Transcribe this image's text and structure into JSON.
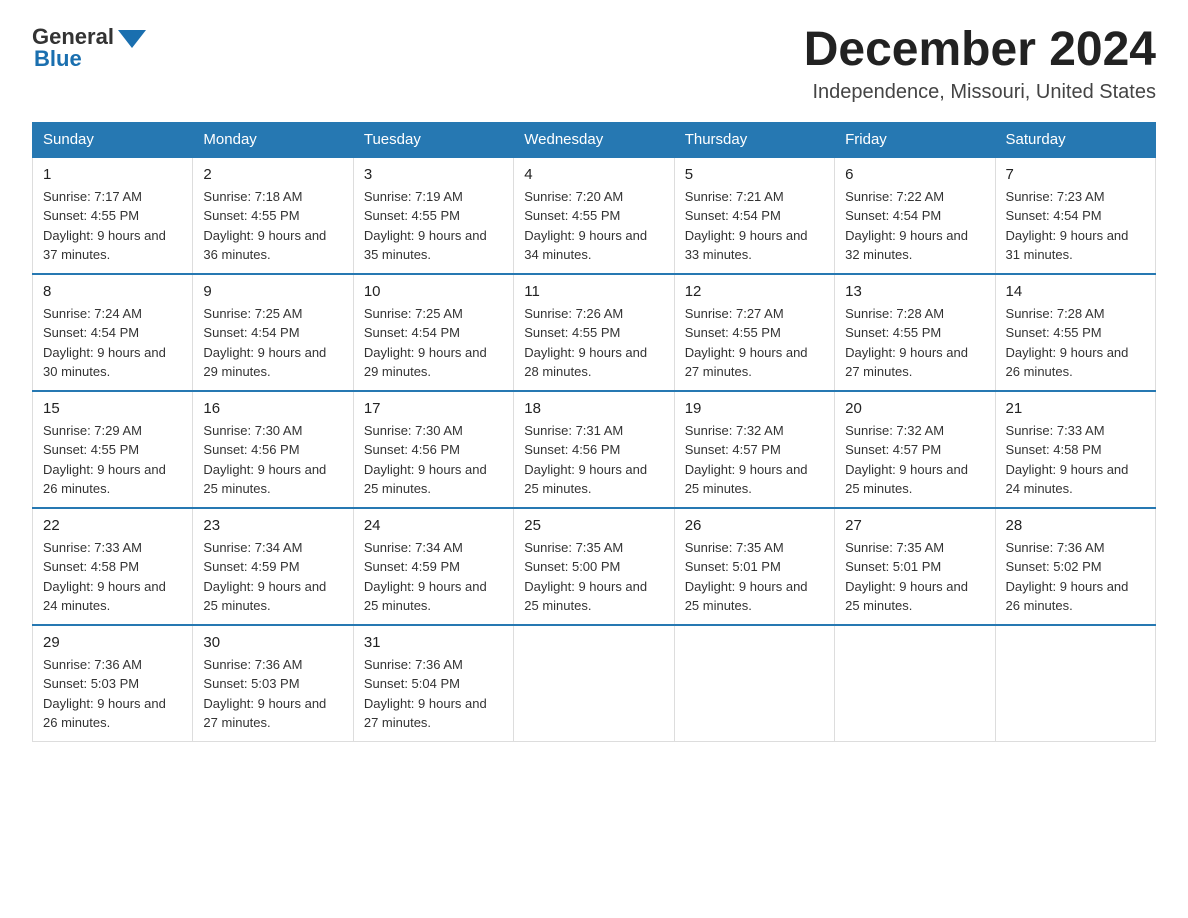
{
  "logo": {
    "general": "General",
    "blue": "Blue"
  },
  "title": "December 2024",
  "subtitle": "Independence, Missouri, United States",
  "headers": [
    "Sunday",
    "Monday",
    "Tuesday",
    "Wednesday",
    "Thursday",
    "Friday",
    "Saturday"
  ],
  "weeks": [
    [
      {
        "day": "1",
        "sunrise": "7:17 AM",
        "sunset": "4:55 PM",
        "daylight": "9 hours and 37 minutes."
      },
      {
        "day": "2",
        "sunrise": "7:18 AM",
        "sunset": "4:55 PM",
        "daylight": "9 hours and 36 minutes."
      },
      {
        "day": "3",
        "sunrise": "7:19 AM",
        "sunset": "4:55 PM",
        "daylight": "9 hours and 35 minutes."
      },
      {
        "day": "4",
        "sunrise": "7:20 AM",
        "sunset": "4:55 PM",
        "daylight": "9 hours and 34 minutes."
      },
      {
        "day": "5",
        "sunrise": "7:21 AM",
        "sunset": "4:54 PM",
        "daylight": "9 hours and 33 minutes."
      },
      {
        "day": "6",
        "sunrise": "7:22 AM",
        "sunset": "4:54 PM",
        "daylight": "9 hours and 32 minutes."
      },
      {
        "day": "7",
        "sunrise": "7:23 AM",
        "sunset": "4:54 PM",
        "daylight": "9 hours and 31 minutes."
      }
    ],
    [
      {
        "day": "8",
        "sunrise": "7:24 AM",
        "sunset": "4:54 PM",
        "daylight": "9 hours and 30 minutes."
      },
      {
        "day": "9",
        "sunrise": "7:25 AM",
        "sunset": "4:54 PM",
        "daylight": "9 hours and 29 minutes."
      },
      {
        "day": "10",
        "sunrise": "7:25 AM",
        "sunset": "4:54 PM",
        "daylight": "9 hours and 29 minutes."
      },
      {
        "day": "11",
        "sunrise": "7:26 AM",
        "sunset": "4:55 PM",
        "daylight": "9 hours and 28 minutes."
      },
      {
        "day": "12",
        "sunrise": "7:27 AM",
        "sunset": "4:55 PM",
        "daylight": "9 hours and 27 minutes."
      },
      {
        "day": "13",
        "sunrise": "7:28 AM",
        "sunset": "4:55 PM",
        "daylight": "9 hours and 27 minutes."
      },
      {
        "day": "14",
        "sunrise": "7:28 AM",
        "sunset": "4:55 PM",
        "daylight": "9 hours and 26 minutes."
      }
    ],
    [
      {
        "day": "15",
        "sunrise": "7:29 AM",
        "sunset": "4:55 PM",
        "daylight": "9 hours and 26 minutes."
      },
      {
        "day": "16",
        "sunrise": "7:30 AM",
        "sunset": "4:56 PM",
        "daylight": "9 hours and 25 minutes."
      },
      {
        "day": "17",
        "sunrise": "7:30 AM",
        "sunset": "4:56 PM",
        "daylight": "9 hours and 25 minutes."
      },
      {
        "day": "18",
        "sunrise": "7:31 AM",
        "sunset": "4:56 PM",
        "daylight": "9 hours and 25 minutes."
      },
      {
        "day": "19",
        "sunrise": "7:32 AM",
        "sunset": "4:57 PM",
        "daylight": "9 hours and 25 minutes."
      },
      {
        "day": "20",
        "sunrise": "7:32 AM",
        "sunset": "4:57 PM",
        "daylight": "9 hours and 25 minutes."
      },
      {
        "day": "21",
        "sunrise": "7:33 AM",
        "sunset": "4:58 PM",
        "daylight": "9 hours and 24 minutes."
      }
    ],
    [
      {
        "day": "22",
        "sunrise": "7:33 AM",
        "sunset": "4:58 PM",
        "daylight": "9 hours and 24 minutes."
      },
      {
        "day": "23",
        "sunrise": "7:34 AM",
        "sunset": "4:59 PM",
        "daylight": "9 hours and 25 minutes."
      },
      {
        "day": "24",
        "sunrise": "7:34 AM",
        "sunset": "4:59 PM",
        "daylight": "9 hours and 25 minutes."
      },
      {
        "day": "25",
        "sunrise": "7:35 AM",
        "sunset": "5:00 PM",
        "daylight": "9 hours and 25 minutes."
      },
      {
        "day": "26",
        "sunrise": "7:35 AM",
        "sunset": "5:01 PM",
        "daylight": "9 hours and 25 minutes."
      },
      {
        "day": "27",
        "sunrise": "7:35 AM",
        "sunset": "5:01 PM",
        "daylight": "9 hours and 25 minutes."
      },
      {
        "day": "28",
        "sunrise": "7:36 AM",
        "sunset": "5:02 PM",
        "daylight": "9 hours and 26 minutes."
      }
    ],
    [
      {
        "day": "29",
        "sunrise": "7:36 AM",
        "sunset": "5:03 PM",
        "daylight": "9 hours and 26 minutes."
      },
      {
        "day": "30",
        "sunrise": "7:36 AM",
        "sunset": "5:03 PM",
        "daylight": "9 hours and 27 minutes."
      },
      {
        "day": "31",
        "sunrise": "7:36 AM",
        "sunset": "5:04 PM",
        "daylight": "9 hours and 27 minutes."
      },
      null,
      null,
      null,
      null
    ]
  ]
}
